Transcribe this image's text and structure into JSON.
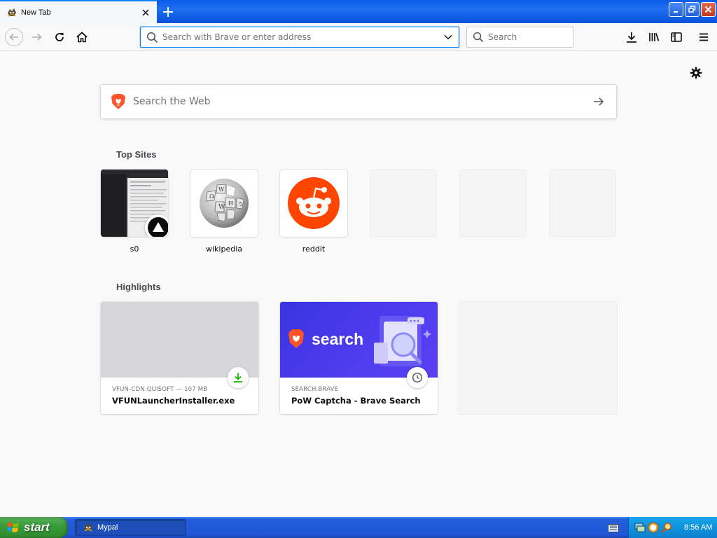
{
  "browser": {
    "tab": {
      "title": "New Tab"
    },
    "urlbar": {
      "placeholder": "Search with Brave or enter address"
    },
    "searchbar": {
      "placeholder": "Search"
    }
  },
  "newtab": {
    "web_search": {
      "placeholder": "Search the Web"
    },
    "top_sites": {
      "title": "Top Sites",
      "items": [
        {
          "label": "s0"
        },
        {
          "label": "wikipedia"
        },
        {
          "label": "reddit"
        }
      ]
    },
    "highlights": {
      "title": "Highlights",
      "items": [
        {
          "host": "VFUN-CDN.QUISOFT — 107 MB",
          "title": "VFUNLauncherInstaller.exe"
        },
        {
          "host": "SEARCH.BRAVE",
          "title": "PoW Captcha - Brave Search",
          "image_text": "search"
        }
      ]
    }
  },
  "taskbar": {
    "start_label": "start",
    "task": {
      "label": "Mypal"
    },
    "clock": "8:56 AM"
  },
  "colors": {
    "accent": "#0a84ff",
    "reddit": "#ff4500",
    "brave_orange": "#fb542b",
    "brave_search_bg": "#3f39e8"
  }
}
